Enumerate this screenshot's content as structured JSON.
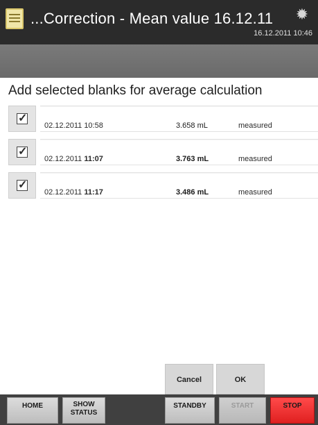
{
  "header": {
    "title": "...Correction - Mean value 16.12.11",
    "datetime": "16.12.2011 10:46",
    "doc_icon": "document-icon",
    "settings_icon": "gear-icon"
  },
  "content": {
    "instruction": "Add selected blanks for average calculation",
    "blanks": [
      {
        "checked": true,
        "date": "02.12.2011",
        "time": "10:58",
        "volume": "3.658 mL",
        "status": "measured"
      },
      {
        "checked": true,
        "date": "02.12.2011",
        "time": "11:07",
        "volume": "3.763 mL",
        "status": "measured"
      },
      {
        "checked": true,
        "date": "02.12.2011",
        "time": "11:17",
        "volume": "3.486 mL",
        "status": "measured"
      }
    ]
  },
  "dialog": {
    "cancel_label": "Cancel",
    "ok_label": "OK"
  },
  "nav": {
    "home": "HOME",
    "show_status_line1": "SHOW",
    "show_status_line2": "STATUS",
    "standby": "STANDBY",
    "start": "START",
    "stop": "STOP"
  },
  "colors": {
    "titlebar": "#2b2b2b",
    "subbar": "#707070",
    "stop": "#f03030"
  }
}
